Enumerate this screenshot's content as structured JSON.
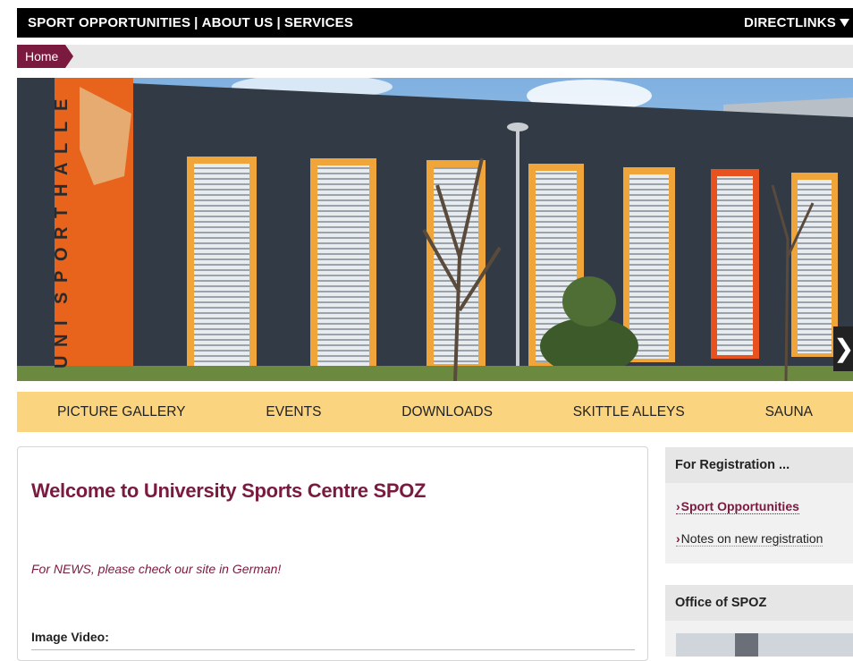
{
  "topbar": {
    "links": [
      "SPORT OPPORTUNITIES",
      "ABOUT US",
      "SERVICES"
    ],
    "separator": "|",
    "directlinks": "DIRECTLINKS",
    "directlinks_icon": "caret-down-icon"
  },
  "breadcrumb": {
    "home": "Home"
  },
  "hero": {
    "sign_text": "UNISPORTHALLE",
    "next_icon": "chevron-right-icon"
  },
  "nav2": {
    "items": [
      "PICTURE GALLERY",
      "EVENTS",
      "DOWNLOADS",
      "SKITTLE ALLEYS",
      "SAUNA"
    ]
  },
  "main": {
    "title": "Welcome to University Sports Centre SPOZ",
    "news": "For NEWS, please check our site in German!",
    "image_video": "Image Video:"
  },
  "sidebar": {
    "registration": {
      "title": "For Registration ...",
      "links": [
        "Sport Opportunities",
        "Notes on new registration"
      ]
    },
    "office": {
      "title": "Office of SPOZ"
    }
  },
  "colors": {
    "brand": "#7a1a3f",
    "nav_bg": "#fbd47f",
    "topbar_bg": "#000000"
  }
}
